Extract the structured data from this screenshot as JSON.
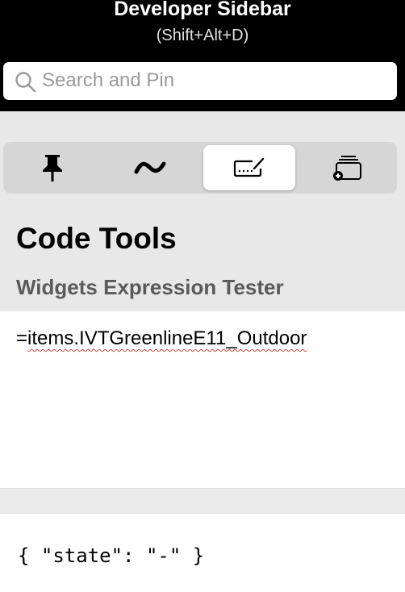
{
  "header": {
    "title": "Developer Sidebar",
    "shortcut": "(Shift+Alt+D)"
  },
  "search": {
    "placeholder": "Search and Pin",
    "value": ""
  },
  "tabs": [
    {
      "icon": "pin-icon",
      "active": false
    },
    {
      "icon": "activity-icon",
      "active": false
    },
    {
      "icon": "code-tools-icon",
      "active": true
    },
    {
      "icon": "add-widget-icon",
      "active": false
    }
  ],
  "section": {
    "title": "Code Tools",
    "subtitle": "Widgets Expression Tester"
  },
  "editor": {
    "prefix": "=",
    "expression": "items.IVTGreenlineE11_Outdoor"
  },
  "result": {
    "text": "{ \"state\": \"-\" }"
  },
  "colors": {
    "header_bg": "#000000",
    "panel_bg": "#e8e8e8",
    "segment_bg": "#d6d6d6",
    "spellcheck": "#e0463c"
  }
}
